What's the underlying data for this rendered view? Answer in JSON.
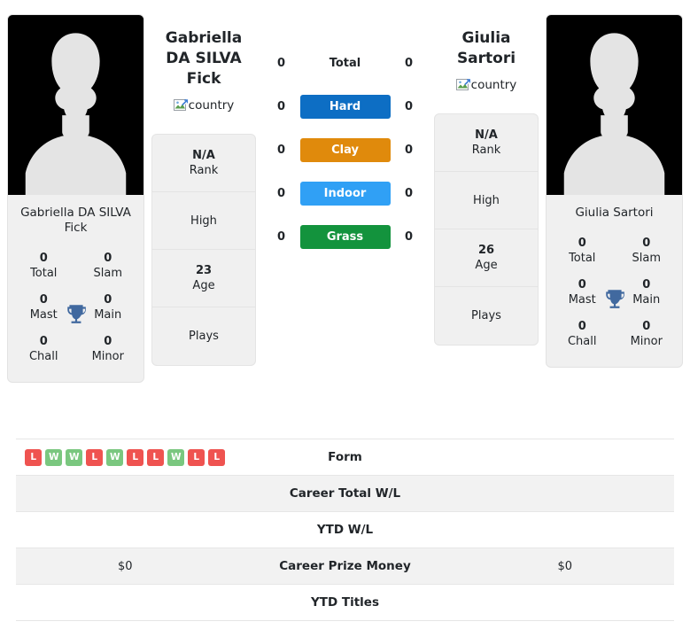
{
  "colors": {
    "hard": "#0d6ec4",
    "clay": "#e08a0c",
    "indoor": "#30a0f5",
    "grass": "#13933d",
    "win": "#7ac77f",
    "loss": "#ef5350",
    "trophy": "#41699f",
    "card_bg": "#f0f0f0",
    "row_shaded": "#f2f2f2"
  },
  "left_player": {
    "name": "Gabriella DA SILVA Fick",
    "country_alt": "country",
    "country_icon": "broken-image-icon",
    "card_name": "Gabriella DA SILVA Fick",
    "titles": [
      {
        "value": "0",
        "label": "Total"
      },
      {
        "value": "0",
        "label": "Slam"
      },
      {
        "value": "0",
        "label": "Mast"
      },
      {
        "value": "0",
        "label": "Main"
      },
      {
        "value": "0",
        "label": "Chall"
      },
      {
        "value": "0",
        "label": "Minor"
      }
    ],
    "trophy_icon": "trophy-icon",
    "info": [
      {
        "value": "N/A",
        "label": "Rank"
      },
      {
        "value": "",
        "label": "High"
      },
      {
        "value": "23",
        "label": "Age"
      },
      {
        "value": "",
        "label": "Plays"
      }
    ],
    "surface_counts": {
      "total": "0",
      "hard": "0",
      "clay": "0",
      "indoor": "0",
      "grass": "0"
    },
    "form": [
      "L",
      "W",
      "W",
      "L",
      "W",
      "L",
      "L",
      "W",
      "L",
      "L"
    ],
    "career_total_wl": "",
    "ytd_wl": "",
    "career_prize_money": "$0",
    "ytd_titles": ""
  },
  "right_player": {
    "name": "Giulia Sartori",
    "country_alt": "country",
    "country_icon": "broken-image-icon",
    "card_name": "Giulia Sartori",
    "titles": [
      {
        "value": "0",
        "label": "Total"
      },
      {
        "value": "0",
        "label": "Slam"
      },
      {
        "value": "0",
        "label": "Mast"
      },
      {
        "value": "0",
        "label": "Main"
      },
      {
        "value": "0",
        "label": "Chall"
      },
      {
        "value": "0",
        "label": "Minor"
      }
    ],
    "trophy_icon": "trophy-icon",
    "info": [
      {
        "value": "N/A",
        "label": "Rank"
      },
      {
        "value": "",
        "label": "High"
      },
      {
        "value": "26",
        "label": "Age"
      },
      {
        "value": "",
        "label": "Plays"
      }
    ],
    "surface_counts": {
      "total": "0",
      "hard": "0",
      "clay": "0",
      "indoor": "0",
      "grass": "0"
    },
    "form": [],
    "career_total_wl": "",
    "ytd_wl": "",
    "career_prize_money": "$0",
    "ytd_titles": ""
  },
  "surfaces": [
    {
      "key": "total",
      "label": "Total",
      "styled": false
    },
    {
      "key": "hard",
      "label": "Hard",
      "styled": true
    },
    {
      "key": "clay",
      "label": "Clay",
      "styled": true
    },
    {
      "key": "indoor",
      "label": "Indoor",
      "styled": true
    },
    {
      "key": "grass",
      "label": "Grass",
      "styled": true
    }
  ],
  "table_rows": [
    {
      "label": "Form",
      "shaded": false
    },
    {
      "label": "Career Total W/L",
      "shaded": true
    },
    {
      "label": "YTD W/L",
      "shaded": false
    },
    {
      "label": "Career Prize Money",
      "shaded": true
    },
    {
      "label": "YTD Titles",
      "shaded": false
    }
  ]
}
